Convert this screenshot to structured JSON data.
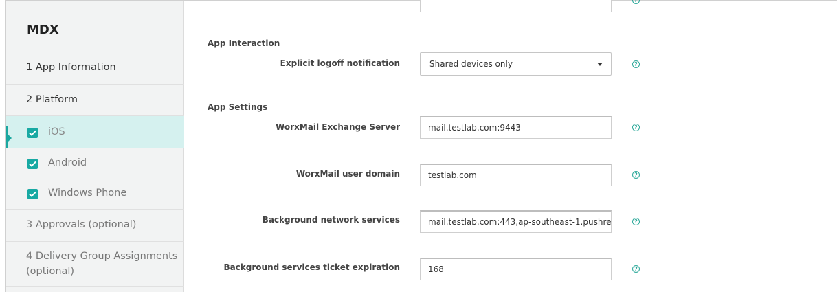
{
  "sidebar": {
    "title": "MDX",
    "steps": [
      {
        "label": "1 App Information"
      },
      {
        "label": "2 Platform"
      },
      {
        "label": "iOS",
        "checked": true,
        "active": true
      },
      {
        "label": "Android",
        "checked": true
      },
      {
        "label": "Windows Phone",
        "checked": true
      },
      {
        "label": "3 Approvals (optional)"
      },
      {
        "label": "4 Delivery Group Assignments"
      },
      {
        "label": "(optional)"
      }
    ]
  },
  "main": {
    "app_interaction": {
      "heading": "App Interaction",
      "logoff_label": "Explicit logoff notification",
      "logoff_value": "Shared devices only"
    },
    "app_settings": {
      "heading": "App Settings",
      "fields": [
        {
          "label": "WorxMail Exchange Server",
          "value": "mail.testlab.com:9443"
        },
        {
          "label": "WorxMail user domain",
          "value": "testlab.com"
        },
        {
          "label": "Background network services",
          "value": "mail.testlab.com:443,ap-southeast-1.pushre"
        },
        {
          "label": "Background services ticket expiration",
          "value": "168"
        }
      ]
    },
    "help_glyph": "?"
  },
  "colors": {
    "accent": "#18a9a3",
    "active_bg": "#d5f1ef",
    "sidebar_bg": "#f2f3f3"
  }
}
